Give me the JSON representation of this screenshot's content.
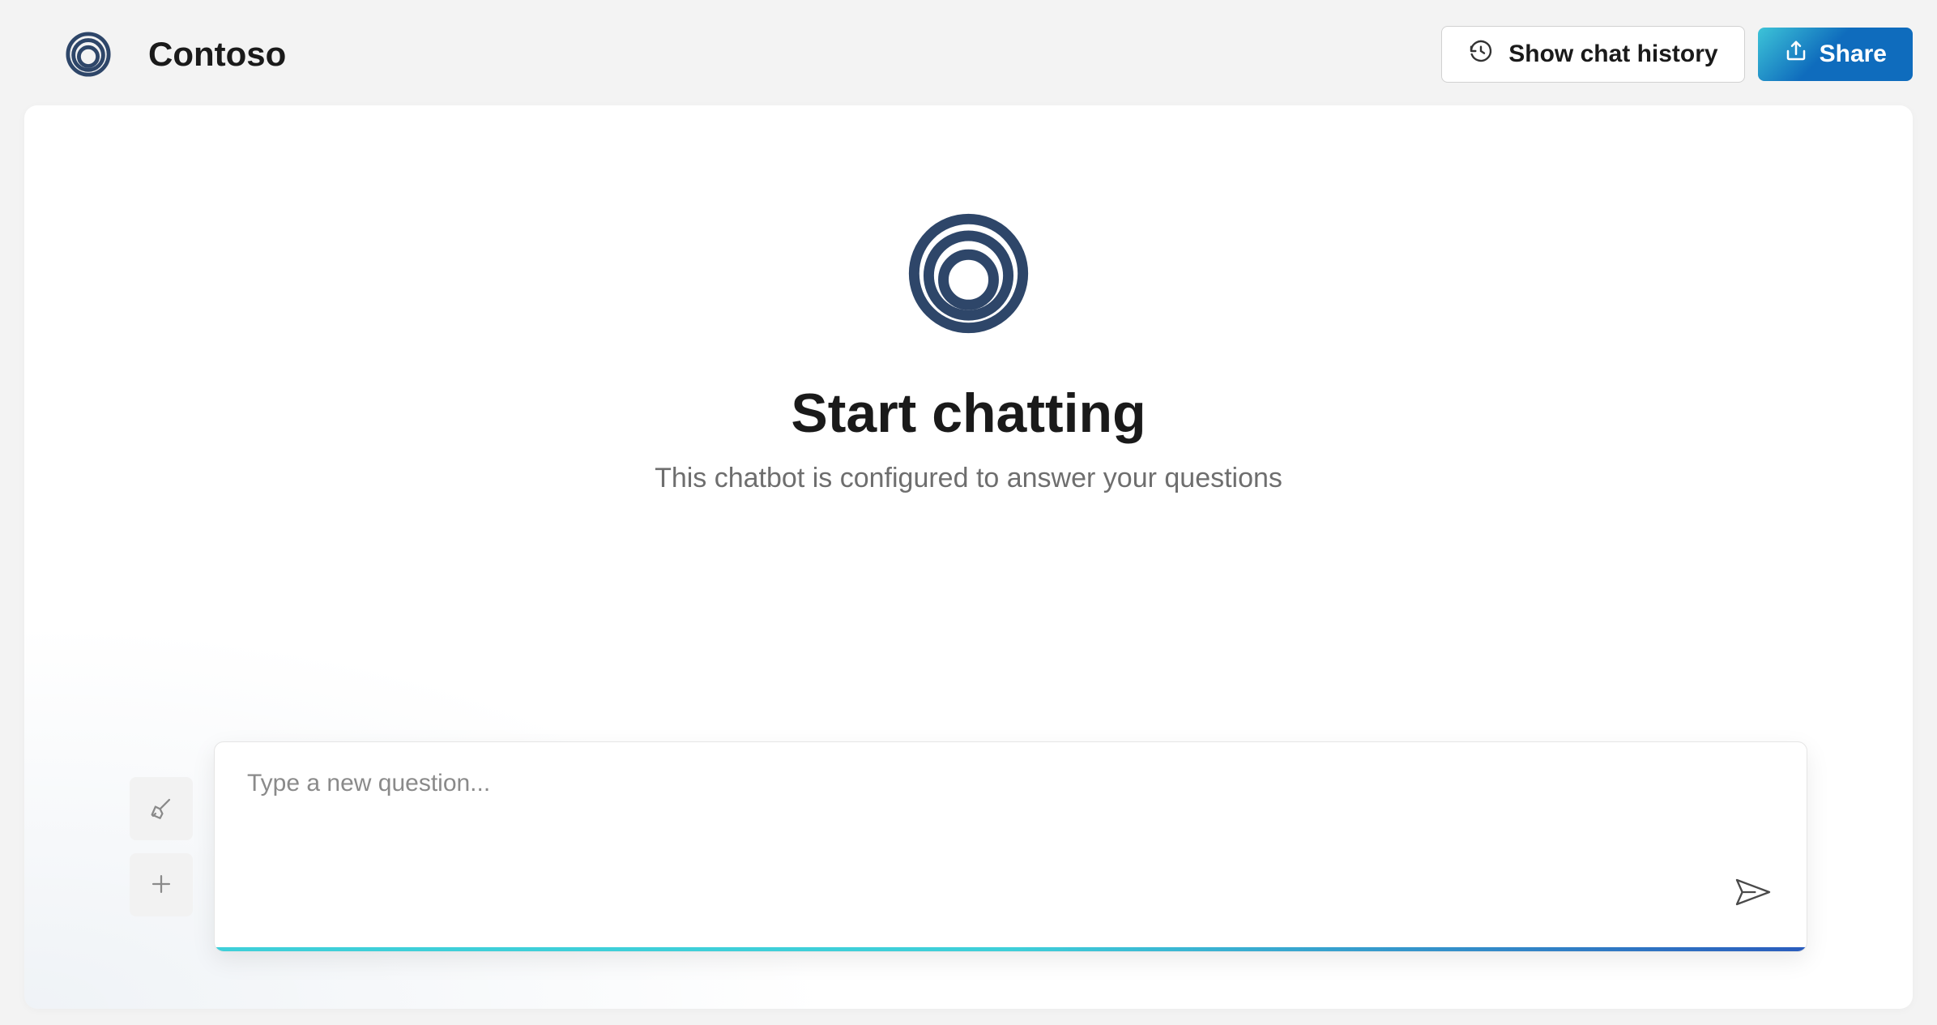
{
  "header": {
    "brand": "Contoso",
    "history_button_label": "Show chat history",
    "share_button_label": "Share"
  },
  "empty_state": {
    "title": "Start chatting",
    "subtitle": "This chatbot is configured to answer your questions"
  },
  "input": {
    "placeholder": "Type a new question..."
  },
  "colors": {
    "brand_dark": "#2e4669",
    "gradient_start": "#3ecfd9",
    "gradient_end": "#2a5cbd",
    "share_blue": "#0f6cbd"
  }
}
